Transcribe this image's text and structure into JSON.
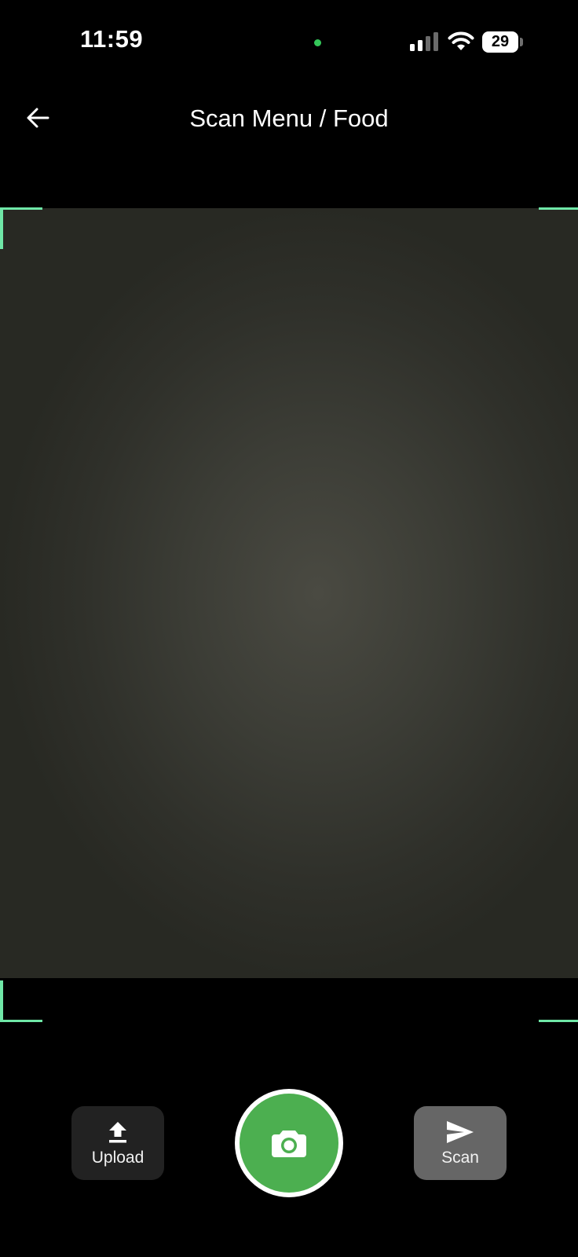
{
  "status_bar": {
    "time": "11:59",
    "battery_level": "29",
    "icons": [
      "signal-icon",
      "wifi-icon",
      "battery-icon"
    ],
    "privacy_indicator_color": "#34c759"
  },
  "header": {
    "title": "Scan Menu / Food",
    "back_icon": "arrow-left-icon"
  },
  "scan_frame": {
    "corner_color": "#6fe7a7"
  },
  "controls": {
    "upload": {
      "label": "Upload",
      "icon": "upload-icon"
    },
    "capture": {
      "icon": "camera-icon",
      "color": "#4caf50"
    },
    "scan": {
      "label": "Scan",
      "icon": "send-icon"
    }
  }
}
